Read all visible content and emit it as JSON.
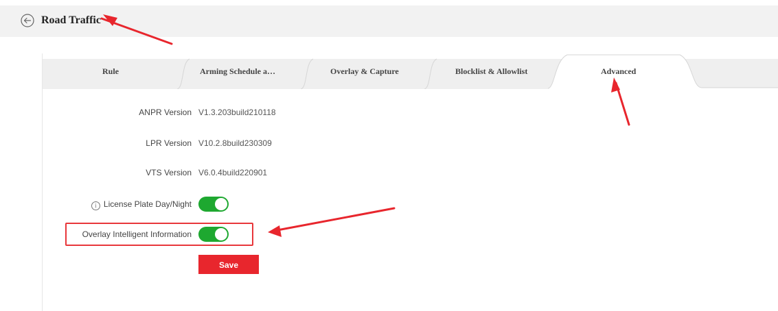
{
  "header": {
    "title": "Road Traffic",
    "back_icon": "back-arrow-circle-icon"
  },
  "tabs": [
    {
      "label": "Rule",
      "active": false
    },
    {
      "label": "Arming Schedule a…",
      "active": false
    },
    {
      "label": "Overlay & Capture",
      "active": false
    },
    {
      "label": "Blocklist & Allowlist",
      "active": false
    },
    {
      "label": "Advanced",
      "active": true
    }
  ],
  "versions": {
    "anpr": {
      "label": "ANPR Version",
      "value": "V1.3.203build210118"
    },
    "lpr": {
      "label": "LPR Version",
      "value": "V10.2.8build230309"
    },
    "vts": {
      "label": "VTS Version",
      "value": "V6.0.4build220901"
    }
  },
  "toggles": {
    "license_plate": {
      "label": "License Plate Day/Night",
      "on": true,
      "info_icon": "info-icon"
    },
    "overlay_info": {
      "label": "Overlay Intelligent Information",
      "on": true
    }
  },
  "actions": {
    "save_label": "Save"
  },
  "colors": {
    "accent": "#e8262d",
    "toggle_on": "#1ea830",
    "annotation": "#e8363a",
    "header_bg": "#f2f2f2"
  }
}
